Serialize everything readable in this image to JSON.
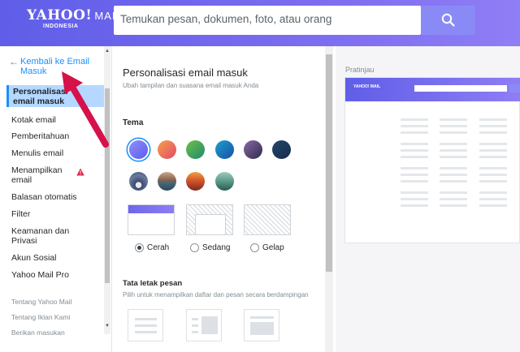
{
  "header": {
    "logo_main": "YAHOO!",
    "logo_mail": "MAIL",
    "logo_sub": "INDONESIA",
    "search_placeholder": "Temukan pesan, dokumen, foto, atau orang"
  },
  "sidebar": {
    "back_label": "Kembali ke Email Masuk",
    "active_item": "Personalisasi email masuk",
    "items": [
      "Kotak email",
      "Pemberitahuan",
      "Menulis email",
      "Menampilkan email",
      "Balasan otomatis",
      "Filter",
      "Keamanan dan Privasi",
      "Akun Sosial",
      "Yahoo Mail Pro"
    ],
    "small_links": [
      "Tentang Yahoo Mail",
      "Tentang Iklan Kami",
      "Berikan masukan"
    ]
  },
  "panel": {
    "title": "Personalisasi email masuk",
    "subtitle": "Ubah tampilan dan suasana email masuk Anda",
    "theme_heading": "Tema",
    "modes": [
      {
        "label": "Cerah",
        "selected": true
      },
      {
        "label": "Sedang",
        "selected": false
      },
      {
        "label": "Gelap",
        "selected": false
      }
    ],
    "layout_heading": "Tata letak pesan",
    "layout_subtitle": "Pilih untuk menampilkan daftar dan pesan secara berdampingan"
  },
  "preview": {
    "label": "Pratinjau",
    "logo": "YAHOO! MAIL"
  },
  "colors": {
    "accent": "#188fff",
    "header": "#6d66ec",
    "swatches": [
      "#7b7cf7",
      "#f0764f",
      "#3aa05e",
      "#1a78c2",
      "#5b4d7e",
      "#1e3a5c"
    ]
  }
}
